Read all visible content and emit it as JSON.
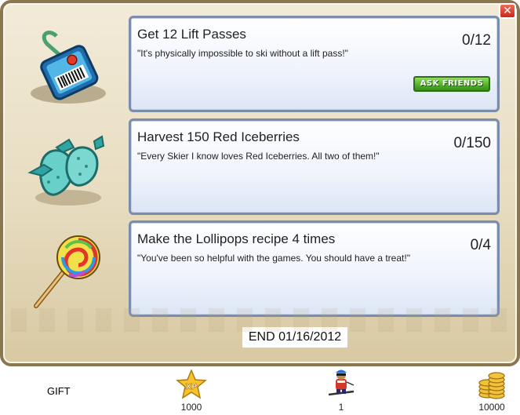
{
  "dialog": {
    "close_label": "✕"
  },
  "tasks": [
    {
      "title": "Get 12 Lift Passes",
      "quote": "\"It's physically impossible to ski without a lift pass!\"",
      "progress": "0/12",
      "button": "ASK FRIENDS",
      "icon": "lift-pass-icon"
    },
    {
      "title": "Harvest 150 Red Iceberries",
      "quote": "\"Every Skier I know loves Red Iceberries. All two of them!\"",
      "progress": "0/150",
      "icon": "iceberries-icon"
    },
    {
      "title": "Make the Lollipops recipe 4 times",
      "quote": "\"You've been so helpful with the games. You should have a treat!\"",
      "progress": "0/4",
      "icon": "lollipop-icon"
    }
  ],
  "end_date": "END 01/16/2012",
  "rewards": {
    "gift_label": "GIFT",
    "xp": {
      "value": "1000",
      "icon_text": "XP"
    },
    "skier": {
      "value": "1"
    },
    "coins": {
      "value": "10000"
    }
  },
  "colors": {
    "card_border": "#7b8dab",
    "ask_button": "#4fb02a",
    "close": "#c62a1c"
  }
}
